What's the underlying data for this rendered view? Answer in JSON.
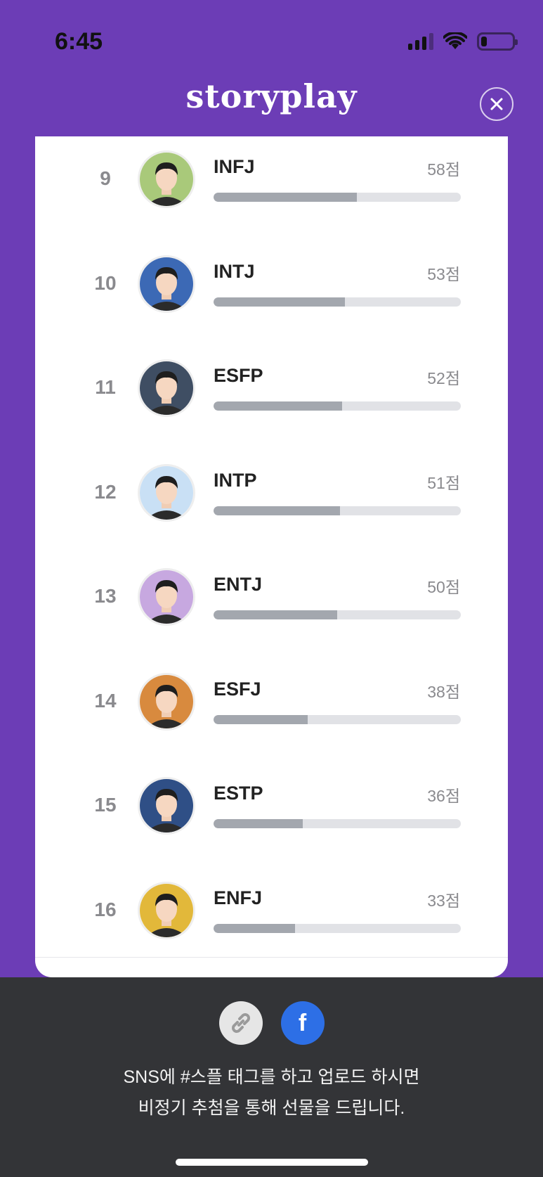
{
  "status": {
    "time": "6:45",
    "signal_icon": "cellular-signal-icon",
    "wifi_icon": "wifi-icon",
    "battery_icon": "battery-low-icon"
  },
  "header": {
    "logo": "storyplay",
    "close_icon": "close-icon"
  },
  "colors": {
    "brand": "#6c3db6",
    "bar_fill": "#a3a7ae",
    "bar_track": "#e1e2e6",
    "facebook": "#2d6fe6",
    "footer_bg": "#333437"
  },
  "results": [
    {
      "rank": "9",
      "type": "INFJ",
      "score": "58점",
      "score_value": 58,
      "avatar_bg": "#a9c97a"
    },
    {
      "rank": "10",
      "type": "INTJ",
      "score": "53점",
      "score_value": 53,
      "avatar_bg": "#3c69b5"
    },
    {
      "rank": "11",
      "type": "ESFP",
      "score": "52점",
      "score_value": 52,
      "avatar_bg": "#3f4e63"
    },
    {
      "rank": "12",
      "type": "INTP",
      "score": "51점",
      "score_value": 51,
      "avatar_bg": "#c9e0f5"
    },
    {
      "rank": "13",
      "type": "ENTJ",
      "score": "50점",
      "score_value": 50,
      "avatar_bg": "#c7a8e0"
    },
    {
      "rank": "14",
      "type": "ESFJ",
      "score": "38점",
      "score_value": 38,
      "avatar_bg": "#d88a3e"
    },
    {
      "rank": "15",
      "type": "ESTP",
      "score": "36점",
      "score_value": 36,
      "avatar_bg": "#2f4f86"
    },
    {
      "rank": "16",
      "type": "ENFJ",
      "score": "33점",
      "score_value": 33,
      "avatar_bg": "#e2b83a"
    }
  ],
  "footer": {
    "link_icon": "link-icon",
    "facebook_icon": "facebook-icon",
    "facebook_glyph": "f",
    "line1": "SNS에 #스플 태그를 하고 업로드 하시면",
    "line2": "비정기 추첨을 통해 선물을 드립니다."
  }
}
